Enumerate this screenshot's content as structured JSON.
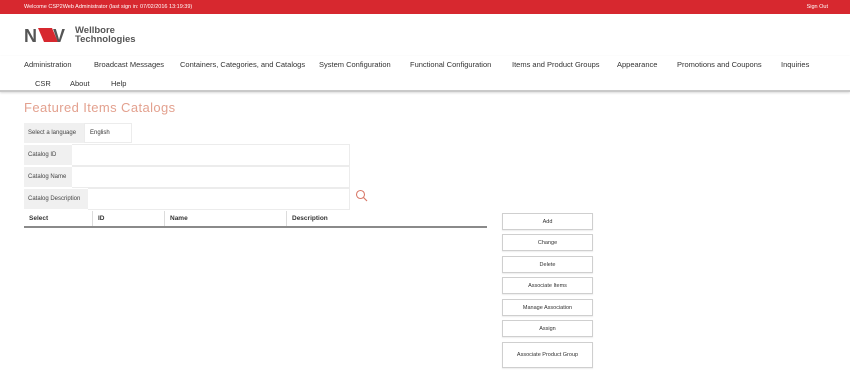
{
  "topbar": {
    "welcome": "Welcome CSP2Web Administrator (last sign in: 07/02/2016 13:19:39)",
    "sign_out": "Sign Out"
  },
  "logo": {
    "line1": "Wellbore",
    "line2": "Technologies"
  },
  "nav": [
    "Administration",
    "Broadcast Messages",
    "Containers, Categories, and Catalogs",
    "System Configuration",
    "Functional Configuration",
    "Items and Product Groups",
    "Appearance",
    "Promotions and Coupons",
    "Inquiries",
    "CSR",
    "About",
    "Help"
  ],
  "page_title": "Featured Items Catalogs",
  "form": {
    "language_label": "Select a language",
    "language_value": "English",
    "catalog_id_label": "Catalog ID",
    "catalog_name_label": "Catalog Name",
    "catalog_description_label": "Catalog Description"
  },
  "table": {
    "columns": [
      "Select",
      "ID",
      "Name",
      "Description"
    ]
  },
  "buttons": {
    "add": "Add",
    "change": "Change",
    "delete": "Delete",
    "associate_items": "Associate Items",
    "manage_association": "Manage Association",
    "assign": "Assign",
    "associate_product_group": "Associate Product Group"
  },
  "colors": {
    "brand_red": "#d7282f",
    "title_color": "#e3a18f"
  }
}
